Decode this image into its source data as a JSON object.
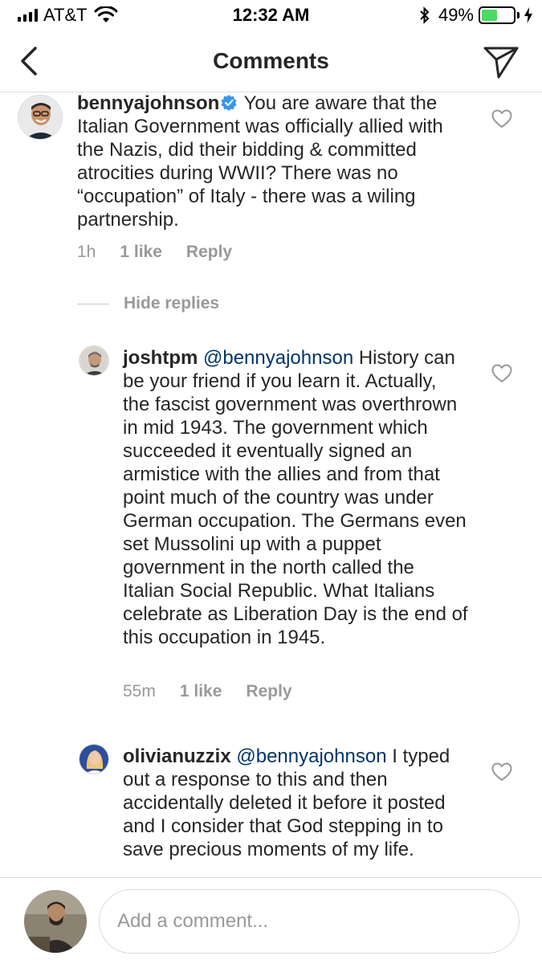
{
  "status_bar": {
    "carrier": "AT&T",
    "time": "12:32 AM",
    "battery_percent": "49%",
    "battery_level": 0.49,
    "battery_color": "#4cd964"
  },
  "nav": {
    "title": "Comments",
    "back_icon": "chevron-left-icon",
    "share_icon": "paper-plane-icon"
  },
  "comments": [
    {
      "username": "bennyajohnson",
      "verified": true,
      "mention": "",
      "text": "You are aware that the Italian Government was officially allied with the Nazis, did their bidding & committed atrocities during WWII? There was no “occupation” of Italy - there was a wiling partnership.",
      "time": "1h",
      "likes": "1 like",
      "reply": "Reply"
    },
    {
      "username": "joshtpm",
      "verified": false,
      "mention": "@bennyajohnson",
      "text": "History can be your friend if you learn it. Actually, the fascist government was overthrown in mid 1943. The government which succeeded it eventually signed an armistice with the allies and from that point much of the country was under German occupation. The Germans even set Mussolini up with a puppet government in the north called the Italian Social Republic. What Italians celebrate as Liberation Day is the end of this occupation in 1945.",
      "time": "55m",
      "likes": "1 like",
      "reply": "Reply"
    },
    {
      "username": "olivianuzzix",
      "verified": false,
      "mention": "@bennyajohnson",
      "text": "I typed out a response to this and then accidentally deleted it before it posted and I consider that God stepping in to save precious moments of my life.",
      "time": "",
      "likes": "",
      "reply": ""
    }
  ],
  "hide_replies": "Hide replies",
  "composer": {
    "placeholder": "Add a comment..."
  },
  "colors": {
    "link": "#003569",
    "verified": "#3897f0",
    "muted": "#999999"
  }
}
